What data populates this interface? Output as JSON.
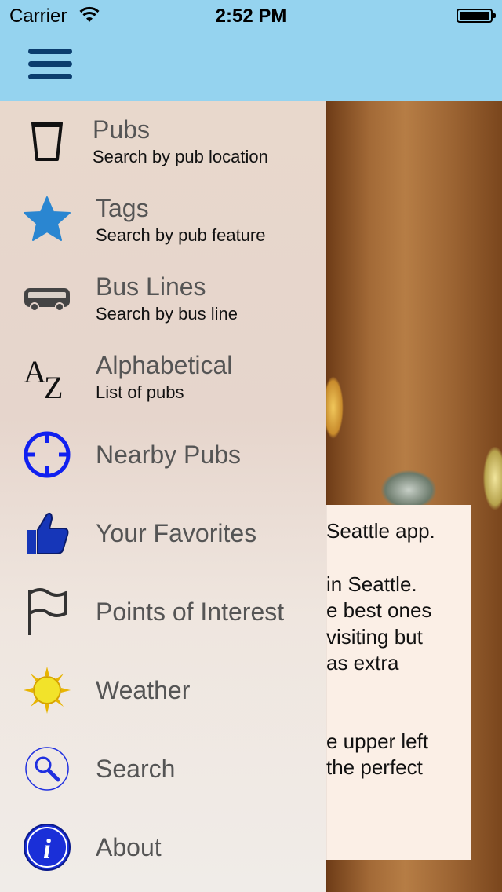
{
  "status_bar": {
    "carrier": "Carrier",
    "time": "2:52 PM"
  },
  "nav": {
    "menu_icon": "hamburger-menu-icon"
  },
  "menu": [
    {
      "icon": "pint-glass-icon",
      "title": "Pubs",
      "subtitle": "Search by pub location"
    },
    {
      "icon": "star-icon",
      "title": "Tags",
      "subtitle": "Search by pub feature"
    },
    {
      "icon": "bus-icon",
      "title": "Bus Lines",
      "subtitle": "Search by bus line"
    },
    {
      "icon": "az-icon",
      "title": "Alphabetical",
      "subtitle": "List of pubs"
    },
    {
      "icon": "crosshair-icon",
      "title": "Nearby Pubs",
      "subtitle": ""
    },
    {
      "icon": "thumbs-up-icon",
      "title": "Your Favorites",
      "subtitle": ""
    },
    {
      "icon": "flag-icon",
      "title": "Points of Interest",
      "subtitle": ""
    },
    {
      "icon": "sun-icon",
      "title": "Weather",
      "subtitle": ""
    },
    {
      "icon": "search-icon",
      "title": "Search",
      "subtitle": ""
    },
    {
      "icon": "info-icon",
      "title": "About",
      "subtitle": ""
    }
  ],
  "background_text": [
    "Seattle app.",
    "in Seattle.",
    "e best ones",
    "visiting but",
    "as extra",
    "e upper left",
    "the perfect"
  ]
}
